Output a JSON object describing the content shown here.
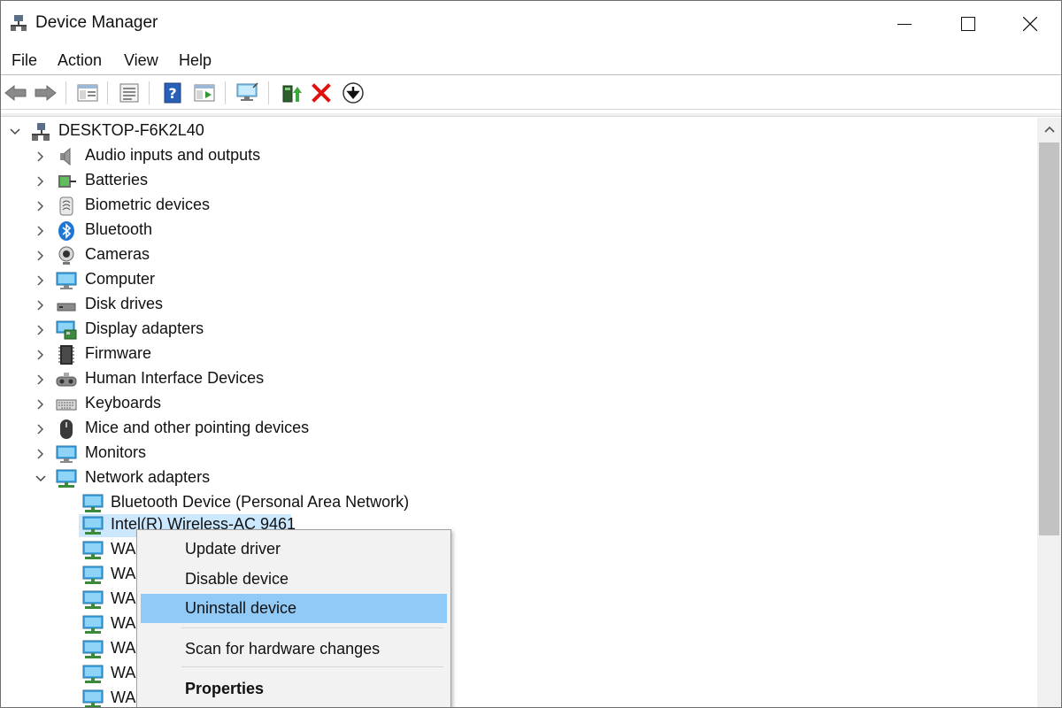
{
  "window": {
    "title": "Device Manager",
    "controls": {
      "minimize": "minimize",
      "maximize": "maximize",
      "close": "close"
    }
  },
  "menu": {
    "file": "File",
    "action": "Action",
    "view": "View",
    "help": "Help"
  },
  "toolbar": {
    "buttons": [
      "back-icon",
      "forward-icon",
      "show-hide-console-tree-icon",
      "properties-icon",
      "help-icon",
      "run-icon",
      "scan-hardware-icon",
      "update-driver-icon",
      "uninstall-icon",
      "install-legacy-icon"
    ]
  },
  "tree": {
    "root": "DESKTOP-F6K2L40",
    "categories": [
      {
        "label": "Audio inputs and outputs",
        "icon": "speaker-icon"
      },
      {
        "label": "Batteries",
        "icon": "battery-icon"
      },
      {
        "label": "Biometric devices",
        "icon": "fingerprint-icon"
      },
      {
        "label": "Bluetooth",
        "icon": "bluetooth-icon"
      },
      {
        "label": "Cameras",
        "icon": "camera-icon"
      },
      {
        "label": "Computer",
        "icon": "computer-icon"
      },
      {
        "label": "Disk drives",
        "icon": "disk-drive-icon"
      },
      {
        "label": "Display adapters",
        "icon": "display-adapter-icon"
      },
      {
        "label": "Firmware",
        "icon": "firmware-icon"
      },
      {
        "label": "Human Interface Devices",
        "icon": "hid-icon"
      },
      {
        "label": "Keyboards",
        "icon": "keyboard-icon"
      },
      {
        "label": "Mice and other pointing devices",
        "icon": "mouse-icon"
      },
      {
        "label": "Monitors",
        "icon": "monitor-icon"
      },
      {
        "label": "Network adapters",
        "icon": "network-icon"
      }
    ],
    "network_children": [
      "Bluetooth Device (Personal Area Network)",
      "Intel(R) Wireless-AC 9461",
      "WA",
      "WA",
      "WA",
      "WA",
      "WA",
      "WA",
      "WA"
    ]
  },
  "context_menu": {
    "items": [
      "Update driver",
      "Disable device",
      "Uninstall device",
      "Scan for hardware changes",
      "Properties"
    ],
    "highlighted": "Uninstall device"
  },
  "colors": {
    "selection": "#cce8ff",
    "menu_highlight": "#91c9f7",
    "uninstall_red": "#e01010"
  }
}
